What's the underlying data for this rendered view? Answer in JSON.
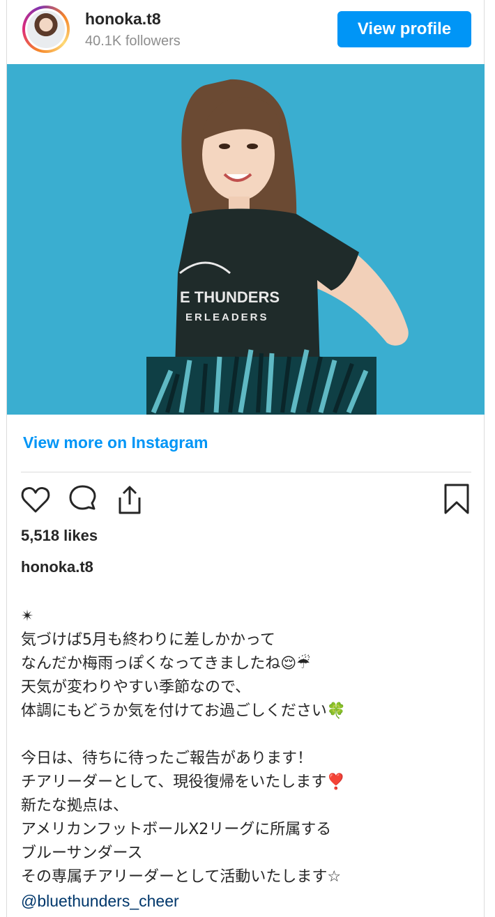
{
  "header": {
    "username": "honoka.t8",
    "followers": "40.1K followers",
    "view_profile_label": "View profile"
  },
  "photo": {
    "shirt_line1": "E THUNDERS",
    "shirt_line2": "ERLEADERS"
  },
  "view_more_label": "View more on Instagram",
  "actions": {
    "like_icon": "heart-icon",
    "comment_icon": "comment-icon",
    "share_icon": "share-icon",
    "save_icon": "bookmark-icon"
  },
  "likes": "5,518 likes",
  "caption": {
    "username": "honoka.t8",
    "lines": [
      "✴",
      "気づけば5月も終わりに差しかかって",
      "なんだか梅雨っぽくなってきましたね😌☔",
      "天気が変わりやすい季節なので、",
      "体調にもどうか気を付けてお過ごしください🍀",
      "",
      "今日は、待ちに待ったご報告があります！",
      "チアリーダーとして、現役復帰をいたします❣️",
      "新たな拠点は、",
      "アメリカンフットボールX2リーグに所属する",
      "ブルーサンダース",
      "その専属チアリーダーとして活動いたします☆"
    ],
    "mention": "@bluethunders_cheer"
  },
  "colors": {
    "accent": "#0095f6",
    "photo_background": "#3aaed0",
    "mention": "#00376b"
  }
}
